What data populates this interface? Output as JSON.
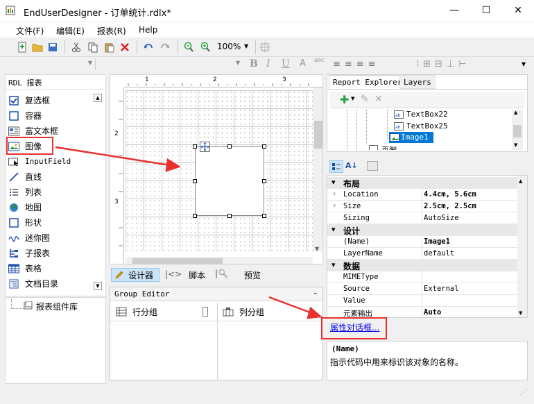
{
  "window": {
    "title": "EndUserDesigner - 订单统计.rdlx*",
    "minimize": "—",
    "maximize": "☐",
    "close": "✕"
  },
  "menu": [
    {
      "label": "文件(F)"
    },
    {
      "label": "编辑(E)"
    },
    {
      "label": "报表(R)"
    },
    {
      "label": "Help"
    }
  ],
  "toolbar": {
    "zoom": "100%"
  },
  "toolbox": {
    "title": "RDL 报表",
    "items": [
      {
        "label": "复选框",
        "icon": "checkbox-icon"
      },
      {
        "label": "容器",
        "icon": "container-icon"
      },
      {
        "label": "富文本框",
        "icon": "richtext-icon"
      },
      {
        "label": "图像",
        "icon": "image-icon"
      },
      {
        "label": "InputField",
        "icon": "inputfield-icon"
      },
      {
        "label": "直线",
        "icon": "line-icon"
      },
      {
        "label": "列表",
        "icon": "list-icon"
      },
      {
        "label": "地图",
        "icon": "map-icon"
      },
      {
        "label": "形状",
        "icon": "shape-icon"
      },
      {
        "label": "迷你图",
        "icon": "sparkline-icon"
      },
      {
        "label": "子报表",
        "icon": "subreport-icon"
      },
      {
        "label": "表格",
        "icon": "table-icon"
      },
      {
        "label": "文档目录",
        "icon": "toc-icon"
      }
    ],
    "library": "报表组件库"
  },
  "ruler": {
    "top_ticks": [
      "1",
      "2",
      "3"
    ],
    "left_ticks": [
      "2",
      "3"
    ]
  },
  "view_tabs": {
    "designer": "设计器",
    "script": "脚本",
    "preview": "预览"
  },
  "group_editor": {
    "title": "Group Editor",
    "row_groups": "行分组",
    "column_groups": "列分组"
  },
  "explorer": {
    "tabs": [
      "Report Explorer",
      "Layers"
    ],
    "tree": [
      "TextBox22",
      "TextBox25",
      "Image1",
      "页脚"
    ]
  },
  "properties": {
    "categories": [
      {
        "name": "布局",
        "rows": [
          {
            "name": "Location",
            "value": "4.4cm, 5.6cm",
            "bold": true,
            "expandable": true
          },
          {
            "name": "Size",
            "value": "2.5cm, 2.5cm",
            "bold": true,
            "expandable": true
          },
          {
            "name": "Sizing",
            "value": "AutoSize",
            "bold": false,
            "expandable": false
          }
        ]
      },
      {
        "name": "设计",
        "rows": [
          {
            "name": "(Name)",
            "value": "Image1",
            "bold": true,
            "expandable": false
          },
          {
            "name": "LayerName",
            "value": "default",
            "bold": false,
            "expandable": false
          }
        ]
      },
      {
        "name": "数据",
        "rows": [
          {
            "name": "MIMEType",
            "value": "",
            "bold": false,
            "expandable": false
          },
          {
            "name": "Source",
            "value": "External",
            "bold": false,
            "expandable": false
          },
          {
            "name": "Value",
            "value": "",
            "bold": false,
            "expandable": false
          },
          {
            "name": "元素输出",
            "value": "Auto",
            "bold": true,
            "expandable": false
          }
        ]
      }
    ],
    "dialog_link": "属性对话框...",
    "desc_title": "(Name)",
    "desc_text": "指示代码中用来标识该对象的名称。"
  },
  "colors": {
    "annotation_red": "#e8312f",
    "selection_blue": "#cce4f7",
    "link_blue": "#0000ee"
  }
}
